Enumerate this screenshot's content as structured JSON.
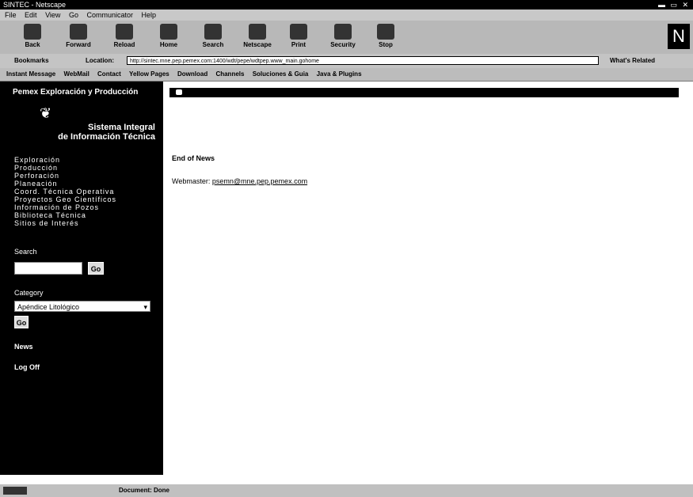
{
  "window": {
    "title": "SINTEC - Netscape",
    "controls": "▬ ▭ ✕"
  },
  "menu": [
    "File",
    "Edit",
    "View",
    "Go",
    "Communicator",
    "Help"
  ],
  "toolbar": {
    "buttons": [
      "Back",
      "Forward",
      "Reload",
      "Home",
      "Search",
      "Netscape",
      "Print",
      "Security",
      "Stop"
    ]
  },
  "location": {
    "bookmarks": "Bookmarks",
    "label": "Location:",
    "url": "http://sintec.mne.pep.pemex.com:1400/wdt/pepe/wdtpep.www_main.gohome",
    "related": "What's Related"
  },
  "links": [
    "Instant Message",
    "WebMail",
    "Contact",
    "Yellow Pages",
    "Download",
    "Channels",
    "Soluciones & Guia",
    "Java & Plugins"
  ],
  "sidebar": {
    "header": "Pemex Exploración y Producción",
    "logo_glyph": "❦",
    "title_line1": "Sistema Integral",
    "title_line2": "de Información Técnica",
    "nav": [
      "Exploración",
      "Producción",
      "Perforación",
      "Planeación",
      "Coord. Técnica Operativa",
      "Proyectos Geo Científicos",
      "Información de Pozos",
      "Biblioteca Técnica",
      "Sitios de Interés"
    ],
    "search_label": "Search",
    "go_label": "Go",
    "category_label": "Category",
    "category_value": "Apéndice Litológico",
    "go2_label": "Go",
    "news": "News",
    "logoff": "Log Off"
  },
  "content": {
    "end_of_news": "End of News",
    "webmaster_label": "Webmaster:",
    "webmaster_email": "psemn@mne.pep.pemex.com"
  },
  "status": {
    "text": "Document: Done"
  }
}
